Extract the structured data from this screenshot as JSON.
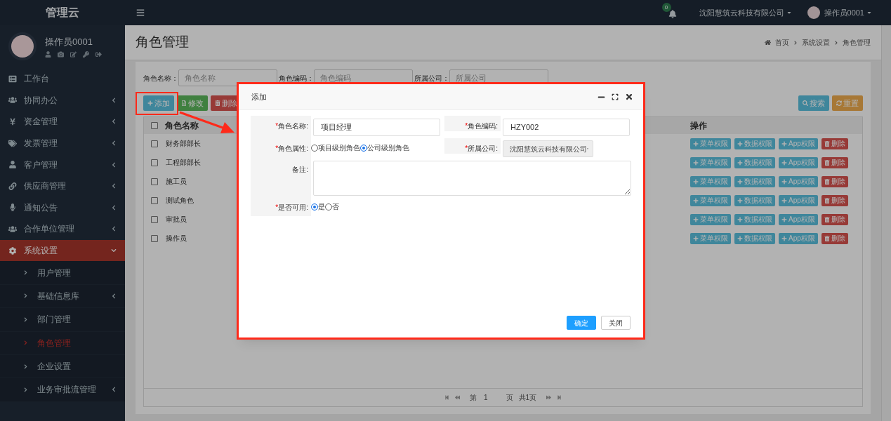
{
  "app_title": "管理云",
  "top_bar": {
    "notification_count": "0",
    "company": "沈阳慧筑云科技有限公司",
    "user": "操作员0001"
  },
  "profile": {
    "name": "操作员0001"
  },
  "sidebar": {
    "items": [
      {
        "label": "工作台",
        "selected": false
      },
      {
        "label": "协同办公",
        "selected": false,
        "expanded": false
      },
      {
        "label": "资金管理",
        "selected": false,
        "expanded": false
      },
      {
        "label": "发票管理",
        "selected": false,
        "expanded": false
      },
      {
        "label": "客户管理",
        "selected": false,
        "expanded": false
      },
      {
        "label": "供应商管理",
        "selected": false,
        "expanded": false
      },
      {
        "label": "通知公告",
        "selected": false,
        "expanded": false
      },
      {
        "label": "合作单位管理",
        "selected": false,
        "expanded": false
      },
      {
        "label": "系统设置",
        "selected": true,
        "expanded": true,
        "children": [
          {
            "label": "用户管理",
            "selected": false
          },
          {
            "label": "基础信息库",
            "selected": false,
            "expanded": false
          },
          {
            "label": "部门管理",
            "selected": false
          },
          {
            "label": "角色管理",
            "selected": true
          },
          {
            "label": "企业设置",
            "selected": false
          },
          {
            "label": "业务审批流管理",
            "selected": false,
            "expanded": false
          }
        ]
      }
    ]
  },
  "page": {
    "title": "角色管理",
    "breadcrumb": [
      "首页",
      "系统设置",
      "角色管理"
    ]
  },
  "filters": [
    {
      "label": "角色名称：",
      "placeholder": "角色名称"
    },
    {
      "label": "角色编码：",
      "placeholder": "角色编码"
    },
    {
      "label": "所属公司：",
      "placeholder": "所属公司"
    }
  ],
  "toolbar": [
    {
      "label": "添加",
      "kind": "add"
    },
    {
      "label": "修改",
      "kind": "edit"
    },
    {
      "label": "删除",
      "kind": "delete"
    }
  ],
  "search_buttons": [
    {
      "label": "搜索",
      "kind": "search"
    },
    {
      "label": "重置",
      "kind": "reset"
    }
  ],
  "table": {
    "columns": [
      "角色名称",
      "操作"
    ],
    "all_checked": false,
    "rows": [
      {
        "checked": false,
        "name": "财务部部长",
        "actions": [
          {
            "label": "菜单权限",
            "kind": "add"
          },
          {
            "label": "数据权限",
            "kind": "add"
          },
          {
            "label": "App权限",
            "kind": "add"
          },
          {
            "label": "删除",
            "kind": "delete"
          }
        ]
      },
      {
        "checked": false,
        "name": "工程部部长",
        "actions": [
          {
            "label": "菜单权限",
            "kind": "add"
          },
          {
            "label": "数据权限",
            "kind": "add"
          },
          {
            "label": "App权限",
            "kind": "add"
          },
          {
            "label": "删除",
            "kind": "delete"
          }
        ]
      },
      {
        "checked": false,
        "name": "施工员",
        "actions": [
          {
            "label": "菜单权限",
            "kind": "add"
          },
          {
            "label": "数据权限",
            "kind": "add"
          },
          {
            "label": "App权限",
            "kind": "add"
          },
          {
            "label": "删除",
            "kind": "delete"
          }
        ]
      },
      {
        "checked": false,
        "name": "测试角色",
        "actions": [
          {
            "label": "菜单权限",
            "kind": "add"
          },
          {
            "label": "数据权限",
            "kind": "add"
          },
          {
            "label": "App权限",
            "kind": "add"
          },
          {
            "label": "删除",
            "kind": "delete"
          }
        ]
      },
      {
        "checked": false,
        "name": "审批员",
        "actions": [
          {
            "label": "菜单权限",
            "kind": "add"
          },
          {
            "label": "数据权限",
            "kind": "add"
          },
          {
            "label": "App权限",
            "kind": "add"
          },
          {
            "label": "删除",
            "kind": "delete"
          }
        ]
      },
      {
        "checked": false,
        "name": "操作员",
        "actions": [
          {
            "label": "菜单权限",
            "kind": "add"
          },
          {
            "label": "数据权限",
            "kind": "add"
          },
          {
            "label": "App权限",
            "kind": "add"
          },
          {
            "label": "删除",
            "kind": "delete"
          }
        ]
      }
    ]
  },
  "pagination": {
    "page_prefix": "第",
    "page": "1",
    "page_suffix": "页",
    "total": "共1页"
  },
  "modal": {
    "title": "添加",
    "fields": [
      {
        "kind": "text",
        "required_mark": "*",
        "label": "角色名称:",
        "value": "项目经理"
      },
      {
        "kind": "text",
        "required_mark": "*",
        "label": "角色编码:",
        "value": "HZY002"
      },
      {
        "kind": "radio",
        "required_mark": "*",
        "label": "角色属性:",
        "options": [
          {
            "label": "项目级别角色",
            "selected": false
          },
          {
            "label": "公司级别角色",
            "selected": true
          }
        ]
      },
      {
        "kind": "select",
        "required_mark": "*",
        "label": "所属公司:",
        "value": "沈阳慧筑云科技有限公司",
        "disabled": true
      },
      {
        "kind": "textarea",
        "label": "备注:"
      },
      {
        "kind": "radio",
        "required_mark": "*",
        "label": "是否可用:",
        "options": [
          {
            "label": "是",
            "selected": true
          },
          {
            "label": "否",
            "selected": false
          }
        ]
      }
    ],
    "buttons": [
      {
        "label": "确定",
        "kind": "primary"
      },
      {
        "label": "关闭",
        "kind": "default"
      }
    ]
  }
}
